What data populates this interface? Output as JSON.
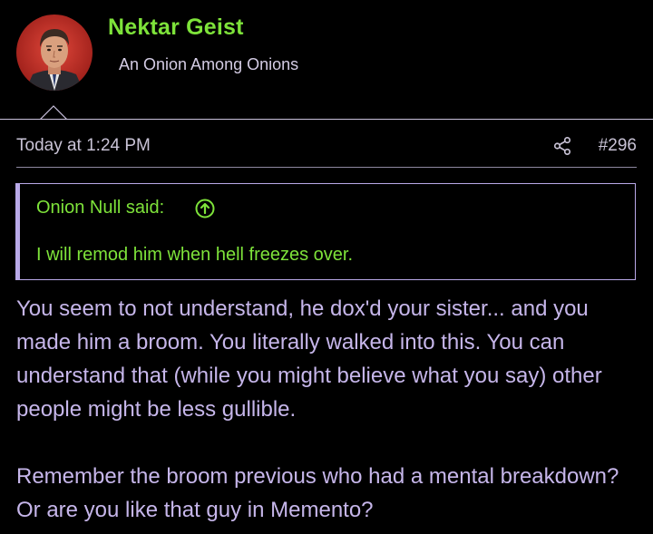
{
  "user": {
    "name": "Nektar Geist",
    "title": "An Onion Among Onions",
    "avatar_icon": "user-avatar-portrait"
  },
  "post": {
    "time": "Today at 1:24 PM",
    "number": "#296",
    "share_icon": "share-icon"
  },
  "quote": {
    "author": "Onion Null said:",
    "text": "I will remod him when hell freezes over.",
    "jump_icon": "arrow-up-circle-icon"
  },
  "body": {
    "paragraphs": [
      "You seem to not understand, he dox'd your sister... and you made him a broom. You literally walked into this. You can understand that (while you might believe what you say) other people might be less gullible.",
      "Remember the broom previous who had a mental breakdown? Or are you like that guy in Memento?"
    ]
  },
  "colors": {
    "username": "#7ee33a",
    "quote_text": "#7ee33a",
    "body_text": "#c6b6ea",
    "quote_border": "#b9a9e8",
    "background": "#000000"
  }
}
